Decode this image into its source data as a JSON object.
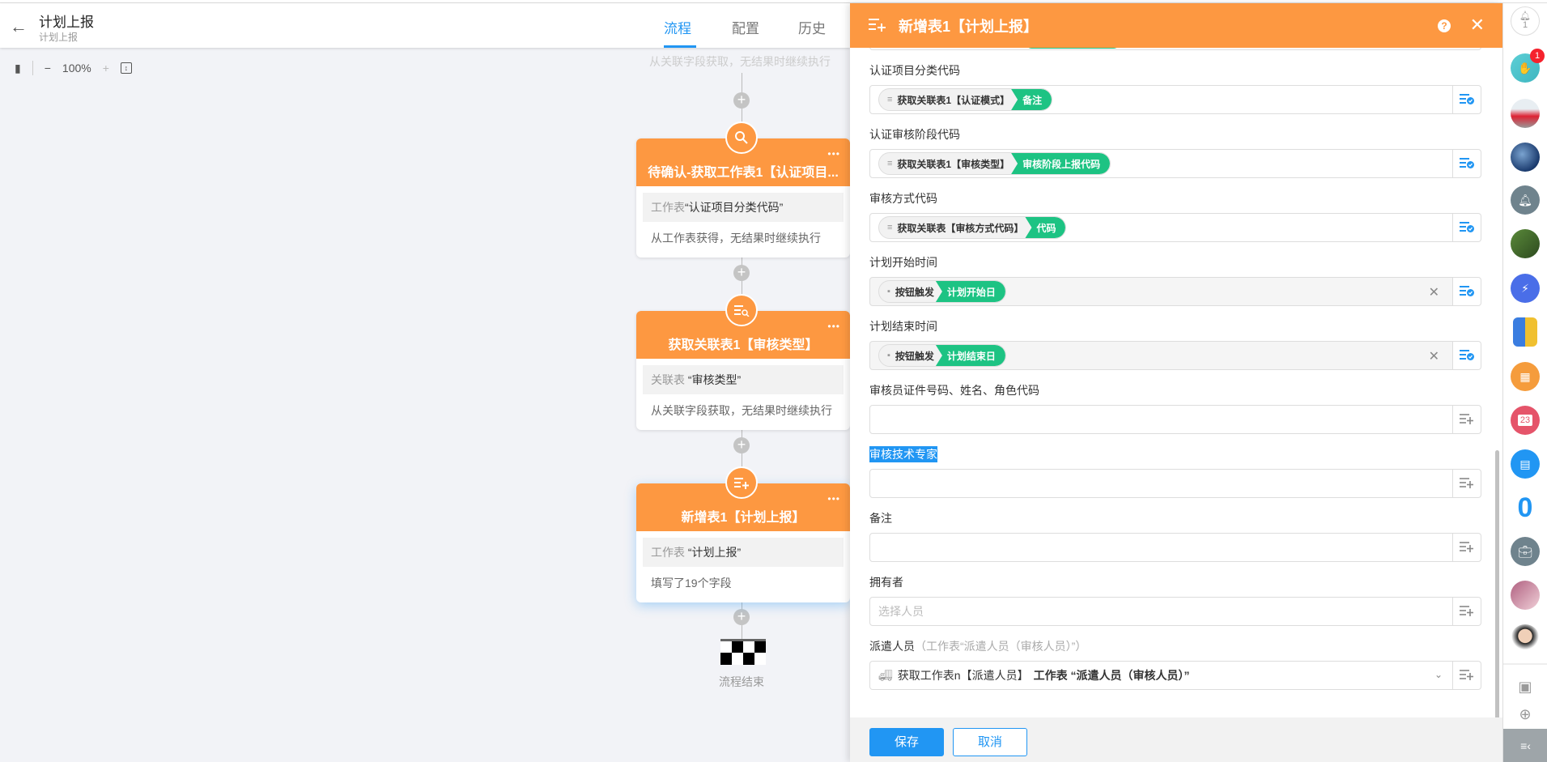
{
  "header": {
    "title": "计划上报",
    "subtitle": "计划上报",
    "tabs": [
      {
        "label": "流程"
      },
      {
        "label": "配置"
      },
      {
        "label": "历史"
      }
    ]
  },
  "zoom": {
    "level": "100%"
  },
  "canvas": {
    "faded_text": "从关联字段获取，无结果时继续执行",
    "nodes": [
      {
        "title": "待确认-获取工作表1【认证项目...",
        "line1_prefix": "工作表",
        "line1_value": "“认证项目分类代码”",
        "line2": "从工作表获得，无结果时继续执行"
      },
      {
        "title": "获取关联表1【审核类型】",
        "line1_prefix": "关联表 ",
        "line1_value": "“审核类型”",
        "line2": "从关联字段获取，无结果时继续执行"
      },
      {
        "title": "新增表1【计划上报】",
        "line1_prefix": "工作表 ",
        "line1_value": "“计划上报”",
        "line2": "填写了19个字段"
      }
    ],
    "end_label": "流程结束"
  },
  "panel": {
    "title": "新增表1【计划上报】",
    "fields": [
      {
        "label": "认证项目分类代码",
        "source": "获取关联表1【认证模式】",
        "value": "备注",
        "source_icon": "list-search-icon"
      },
      {
        "label": "认证审核阶段代码",
        "source": "获取关联表1【审核类型】",
        "value": "审核阶段上报代码",
        "source_icon": "list-search-icon"
      },
      {
        "label": "审核方式代码",
        "source": "获取关联表【审核方式代码】",
        "value": "代码",
        "source_icon": "list-search-icon"
      },
      {
        "label": "计划开始时间",
        "source": "按钮触发",
        "value": "计划开始日",
        "source_icon": "button-trigger-icon",
        "clearable": true
      },
      {
        "label": "计划结束时间",
        "source": "按钮触发",
        "value": "计划结束日",
        "source_icon": "button-trigger-icon",
        "clearable": true
      },
      {
        "label": "审核员证件号码、姓名、角色代码"
      },
      {
        "label": "审核技术专家",
        "highlighted": true
      },
      {
        "label": "备注"
      },
      {
        "label": "拥有者",
        "placeholder": "选择人员"
      },
      {
        "label": "派遣人员",
        "hint": "（工作表“派遣人员（审核人员）”）",
        "dispatch_source": "获取工作表n【派遣人员】",
        "dispatch_value": " 工作表 “派遣人员（审核人员）”"
      }
    ],
    "save_label": "保存",
    "cancel_label": "取消"
  },
  "sidebar": {
    "notification_count": "1",
    "unread_badge": "1",
    "calendar_day": "23",
    "colors": {
      "accent": "#fd9841",
      "primary": "#2196f3",
      "green": "#1dc383"
    }
  }
}
